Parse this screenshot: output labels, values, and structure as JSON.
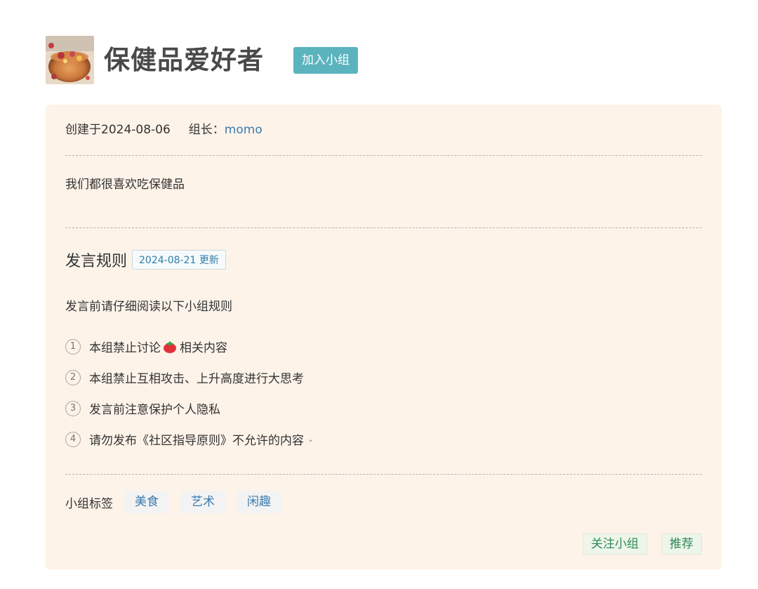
{
  "group": {
    "name": "保健品爱好者",
    "join_label": "加入小组",
    "avatar_icon": "tea-avatar-image"
  },
  "meta": {
    "created": "创建于2024-08-06",
    "owner_label": "组长：",
    "owner_name": "momo"
  },
  "intro": "我们都很喜欢吃保健品",
  "rules": {
    "title": "发言规则",
    "updated": "2024-08-21 更新",
    "description": "发言前请仔细阅读以下小组规则",
    "items": [
      {
        "num": "1",
        "before": "本组禁止讨论",
        "icon": "tomato-icon",
        "after": "相关内容"
      },
      {
        "num": "2",
        "text": "本组禁止互相攻击、上升高度进行大思考"
      },
      {
        "num": "3",
        "text": "发言前注意保护个人隐私"
      },
      {
        "num": "4",
        "text": "请勿发布《社区指导原则》不允许的内容",
        "icon": "chevron-down-icon"
      }
    ]
  },
  "tags": {
    "label": "小组标签",
    "items": [
      "美食",
      "艺术",
      "闲趣"
    ]
  },
  "actions": {
    "follow": "关注小组",
    "recommend": "推荐"
  },
  "colors": {
    "card_bg": "#fdf3e9",
    "join_button": "#5bb3bd",
    "link": "#3b7bb0",
    "action_text": "#2f8a57"
  }
}
